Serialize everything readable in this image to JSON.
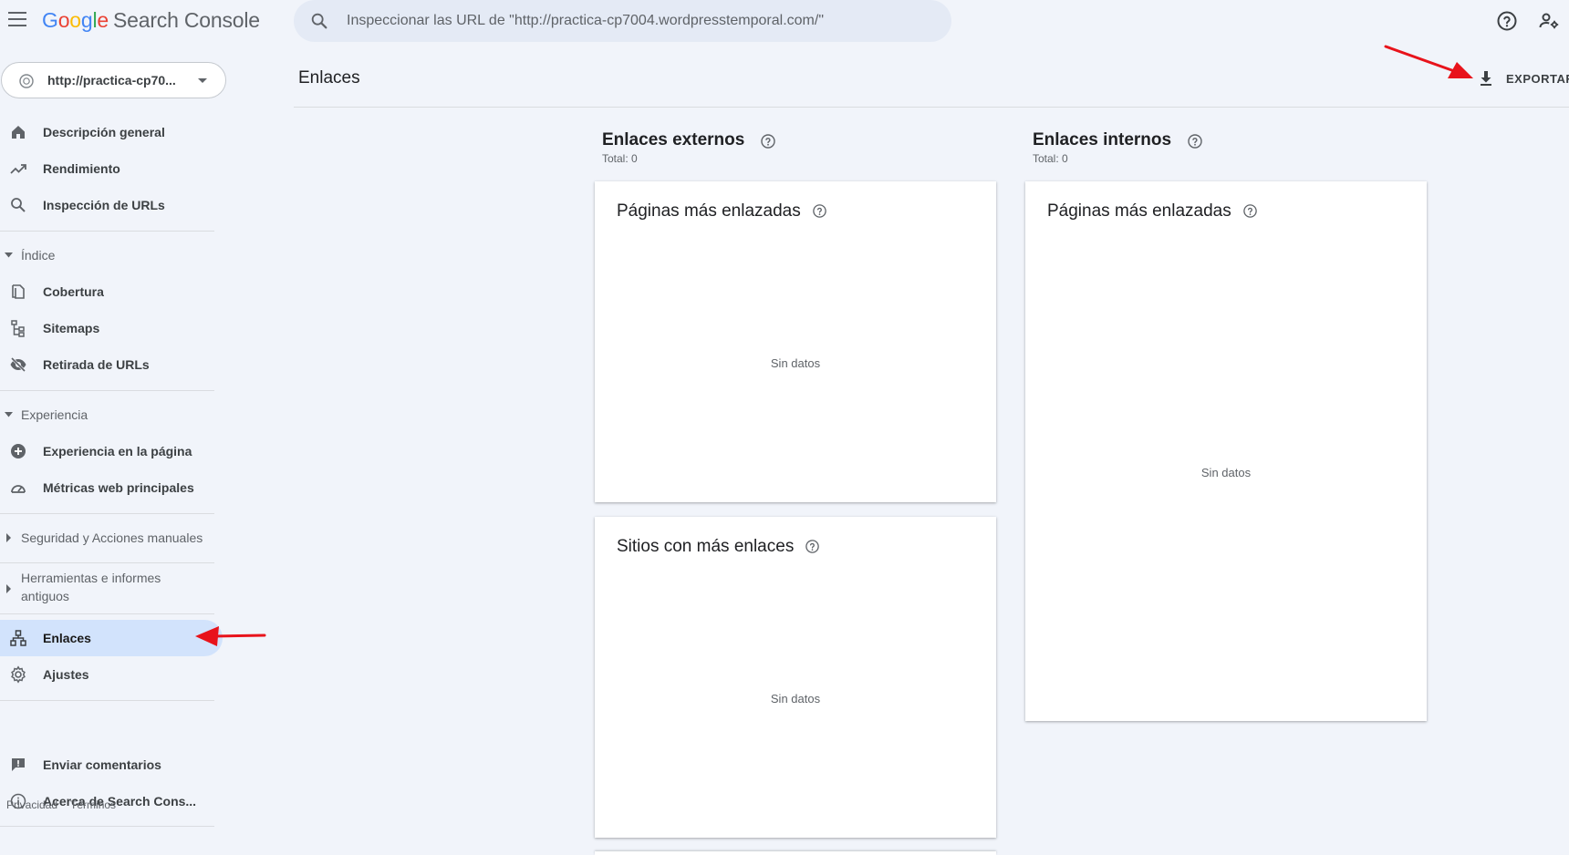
{
  "app": {
    "logo_letters": [
      "G",
      "o",
      "o",
      "g",
      "l",
      "e"
    ],
    "product_name": "Search Console"
  },
  "search": {
    "placeholder": "Inspeccionar las URL de \"http://practica-cp7004.wordpresstemporal.com/\""
  },
  "property": {
    "label": "http://practica-cp70..."
  },
  "sidebar": {
    "items_top": [
      {
        "label": "Descripción general",
        "icon": "home-icon"
      },
      {
        "label": "Rendimiento",
        "icon": "trending-up-icon"
      },
      {
        "label": "Inspección de URLs",
        "icon": "search-icon"
      }
    ],
    "section_indice": "Índice",
    "items_indice": [
      {
        "label": "Cobertura",
        "icon": "copy-pages-icon"
      },
      {
        "label": "Sitemaps",
        "icon": "sitemap-icon"
      },
      {
        "label": "Retirada de URLs",
        "icon": "visibility-off-icon"
      }
    ],
    "section_experiencia": "Experiencia",
    "items_experiencia": [
      {
        "label": "Experiencia en la página",
        "icon": "add-circle-icon"
      },
      {
        "label": "Métricas web principales",
        "icon": "speed-gauge-icon"
      }
    ],
    "section_seguridad": "Seguridad y Acciones manuales",
    "section_herramientas_line1": "Herramientas e informes",
    "section_herramientas_line2": "antiguos",
    "items_bottom": [
      {
        "label": "Enlaces",
        "icon": "links-network-icon",
        "active": true
      },
      {
        "label": "Ajustes",
        "icon": "settings-gear-icon"
      }
    ],
    "items_footer": [
      {
        "label": "Enviar comentarios",
        "icon": "feedback-icon"
      },
      {
        "label": "Acerca de Search Cons...",
        "icon": "info-icon"
      }
    ],
    "footer_links": [
      "Privacidad",
      "Términos"
    ]
  },
  "header": {
    "page_title": "Enlaces",
    "export_label": "EXPORTAR"
  },
  "external": {
    "title": "Enlaces externos",
    "total": "Total: 0",
    "cards": [
      {
        "title": "Páginas más enlazadas",
        "empty": "Sin datos"
      },
      {
        "title": "Sitios con más enlaces",
        "empty": "Sin datos"
      }
    ]
  },
  "internal": {
    "title": "Enlaces internos",
    "total": "Total: 0",
    "cards": [
      {
        "title": "Páginas más enlazadas",
        "empty": "Sin datos"
      }
    ]
  },
  "colors": {
    "background": "#f1f4fa",
    "active_nav": "#d2e3fc",
    "annotation_arrow": "#e8131b"
  }
}
